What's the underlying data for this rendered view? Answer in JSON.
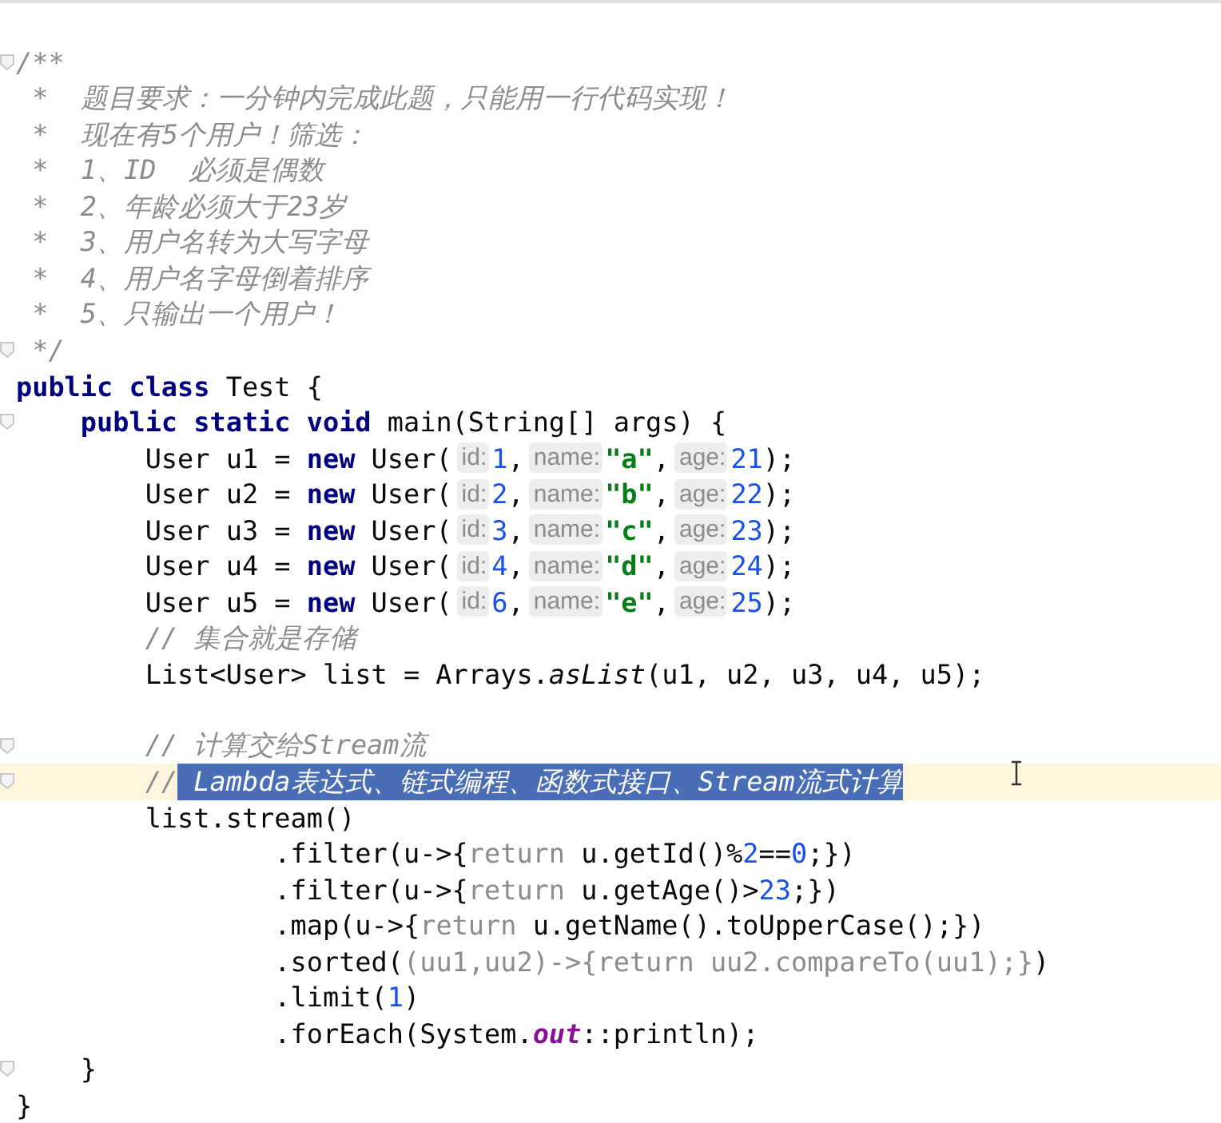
{
  "editor": {
    "lines": [
      {
        "current": false,
        "fold": true,
        "tokens": [
          {
            "kind": "comment",
            "text": "/**"
          }
        ]
      },
      {
        "current": false,
        "fold": false,
        "tokens": [
          {
            "kind": "comment",
            "text": " *  题目要求：一分钟内完成此题，只能用一行代码实现！"
          }
        ]
      },
      {
        "current": false,
        "fold": false,
        "tokens": [
          {
            "kind": "comment",
            "text": " *  现在有5个用户！筛选："
          }
        ]
      },
      {
        "current": false,
        "fold": false,
        "tokens": [
          {
            "kind": "comment",
            "text": " *  1、ID  必须是偶数"
          }
        ]
      },
      {
        "current": false,
        "fold": false,
        "tokens": [
          {
            "kind": "comment",
            "text": " *  2、年龄必须大于23岁"
          }
        ]
      },
      {
        "current": false,
        "fold": false,
        "tokens": [
          {
            "kind": "comment",
            "text": " *  3、用户名转为大写字母"
          }
        ]
      },
      {
        "current": false,
        "fold": false,
        "tokens": [
          {
            "kind": "comment",
            "text": " *  4、用户名字母倒着排序"
          }
        ]
      },
      {
        "current": false,
        "fold": false,
        "tokens": [
          {
            "kind": "comment",
            "text": " *  5、只输出一个用户！"
          }
        ]
      },
      {
        "current": false,
        "fold": true,
        "tokens": [
          {
            "kind": "comment",
            "text": " */"
          }
        ]
      },
      {
        "current": false,
        "fold": false,
        "tokens": [
          {
            "kind": "kw",
            "text": "public class"
          },
          {
            "kind": "plain",
            "text": " Test {"
          }
        ]
      },
      {
        "current": false,
        "fold": true,
        "tokens": [
          {
            "kind": "kw",
            "text": "    public static void"
          },
          {
            "kind": "plain",
            "text": " main(String[] args) {"
          }
        ]
      },
      {
        "current": false,
        "fold": false,
        "tokens": [
          {
            "kind": "plain",
            "text": "        User u1 = "
          },
          {
            "kind": "kw",
            "text": "new"
          },
          {
            "kind": "plain",
            "text": " User("
          },
          {
            "kind": "hint",
            "text": "id:"
          },
          {
            "kind": "num",
            "text": "1"
          },
          {
            "kind": "plain",
            "text": ","
          },
          {
            "kind": "hint",
            "text": "name:"
          },
          {
            "kind": "str",
            "text": "\"a\""
          },
          {
            "kind": "plain",
            "text": ","
          },
          {
            "kind": "hint",
            "text": "age:"
          },
          {
            "kind": "num",
            "text": "21"
          },
          {
            "kind": "plain",
            "text": ");"
          }
        ]
      },
      {
        "current": false,
        "fold": false,
        "tokens": [
          {
            "kind": "plain",
            "text": "        User u2 = "
          },
          {
            "kind": "kw",
            "text": "new"
          },
          {
            "kind": "plain",
            "text": " User("
          },
          {
            "kind": "hint",
            "text": "id:"
          },
          {
            "kind": "num",
            "text": "2"
          },
          {
            "kind": "plain",
            "text": ","
          },
          {
            "kind": "hint",
            "text": "name:"
          },
          {
            "kind": "str",
            "text": "\"b\""
          },
          {
            "kind": "plain",
            "text": ","
          },
          {
            "kind": "hint",
            "text": "age:"
          },
          {
            "kind": "num",
            "text": "22"
          },
          {
            "kind": "plain",
            "text": ");"
          }
        ]
      },
      {
        "current": false,
        "fold": false,
        "tokens": [
          {
            "kind": "plain",
            "text": "        User u3 = "
          },
          {
            "kind": "kw",
            "text": "new"
          },
          {
            "kind": "plain",
            "text": " User("
          },
          {
            "kind": "hint",
            "text": "id:"
          },
          {
            "kind": "num",
            "text": "3"
          },
          {
            "kind": "plain",
            "text": ","
          },
          {
            "kind": "hint",
            "text": "name:"
          },
          {
            "kind": "str",
            "text": "\"c\""
          },
          {
            "kind": "plain",
            "text": ","
          },
          {
            "kind": "hint",
            "text": "age:"
          },
          {
            "kind": "num",
            "text": "23"
          },
          {
            "kind": "plain",
            "text": ");"
          }
        ]
      },
      {
        "current": false,
        "fold": false,
        "tokens": [
          {
            "kind": "plain",
            "text": "        User u4 = "
          },
          {
            "kind": "kw",
            "text": "new"
          },
          {
            "kind": "plain",
            "text": " User("
          },
          {
            "kind": "hint",
            "text": "id:"
          },
          {
            "kind": "num",
            "text": "4"
          },
          {
            "kind": "plain",
            "text": ","
          },
          {
            "kind": "hint",
            "text": "name:"
          },
          {
            "kind": "str",
            "text": "\"d\""
          },
          {
            "kind": "plain",
            "text": ","
          },
          {
            "kind": "hint",
            "text": "age:"
          },
          {
            "kind": "num",
            "text": "24"
          },
          {
            "kind": "plain",
            "text": ");"
          }
        ]
      },
      {
        "current": false,
        "fold": false,
        "tokens": [
          {
            "kind": "plain",
            "text": "        User u5 = "
          },
          {
            "kind": "kw",
            "text": "new"
          },
          {
            "kind": "plain",
            "text": " User("
          },
          {
            "kind": "hint",
            "text": "id:"
          },
          {
            "kind": "num",
            "text": "6"
          },
          {
            "kind": "plain",
            "text": ","
          },
          {
            "kind": "hint",
            "text": "name:"
          },
          {
            "kind": "str",
            "text": "\"e\""
          },
          {
            "kind": "plain",
            "text": ","
          },
          {
            "kind": "hint",
            "text": "age:"
          },
          {
            "kind": "num",
            "text": "25"
          },
          {
            "kind": "plain",
            "text": ");"
          }
        ]
      },
      {
        "current": false,
        "fold": false,
        "tokens": [
          {
            "kind": "comment",
            "text": "        // 集合就是存储"
          }
        ]
      },
      {
        "current": false,
        "fold": false,
        "tokens": [
          {
            "kind": "plain",
            "text": "        List<User> list = Arrays."
          },
          {
            "kind": "italic",
            "text": "asList"
          },
          {
            "kind": "plain",
            "text": "(u1, u2, u3, u4, u5);"
          }
        ]
      },
      {
        "current": false,
        "fold": false
      },
      {
        "current": false,
        "fold": true,
        "tokens": [
          {
            "kind": "comment",
            "text": "        // 计算交给Stream流"
          }
        ]
      },
      {
        "current": true,
        "fold": true,
        "tokens": [
          {
            "kind": "comment",
            "text": "        //"
          },
          {
            "kind": "sel",
            "text": " Lambda表达式、链式编程、函数式接口、Stream流式计算"
          }
        ]
      },
      {
        "current": false,
        "fold": false,
        "tokens": [
          {
            "kind": "plain",
            "text": "        list.stream()"
          }
        ]
      },
      {
        "current": false,
        "fold": false,
        "tokens": [
          {
            "kind": "plain",
            "text": "                .filter(u->{"
          },
          {
            "kind": "dim",
            "text": "return"
          },
          {
            "kind": "plain",
            "text": " u.getId()%"
          },
          {
            "kind": "num",
            "text": "2"
          },
          {
            "kind": "plain",
            "text": "=="
          },
          {
            "kind": "num",
            "text": "0"
          },
          {
            "kind": "plain",
            "text": ";})"
          }
        ]
      },
      {
        "current": false,
        "fold": false,
        "tokens": [
          {
            "kind": "plain",
            "text": "                .filter(u->{"
          },
          {
            "kind": "dim",
            "text": "return"
          },
          {
            "kind": "plain",
            "text": " u.getAge()>"
          },
          {
            "kind": "num",
            "text": "23"
          },
          {
            "kind": "plain",
            "text": ";})"
          }
        ]
      },
      {
        "current": false,
        "fold": false,
        "tokens": [
          {
            "kind": "plain",
            "text": "                .map(u->{"
          },
          {
            "kind": "dim",
            "text": "return"
          },
          {
            "kind": "plain",
            "text": " u.getName().toUpperCase();})"
          }
        ]
      },
      {
        "current": false,
        "fold": false,
        "tokens": [
          {
            "kind": "plain",
            "text": "                .sorted("
          },
          {
            "kind": "dim",
            "text": "(uu1,uu2)->{return uu2.compareTo(uu1);}"
          },
          {
            "kind": "plain",
            "text": ")"
          }
        ]
      },
      {
        "current": false,
        "fold": false,
        "tokens": [
          {
            "kind": "plain",
            "text": "                .limit("
          },
          {
            "kind": "num",
            "text": "1"
          },
          {
            "kind": "plain",
            "text": ")"
          }
        ]
      },
      {
        "current": false,
        "fold": false,
        "tokens": [
          {
            "kind": "plain",
            "text": "                .forEach(System."
          },
          {
            "kind": "field",
            "text": "out"
          },
          {
            "kind": "plain",
            "text": "::println);"
          }
        ]
      },
      {
        "current": false,
        "fold": true,
        "tokens": [
          {
            "kind": "plain",
            "text": "    }"
          }
        ]
      },
      {
        "current": false,
        "fold": false,
        "tokens": [
          {
            "kind": "plain",
            "text": "}"
          }
        ]
      }
    ]
  }
}
